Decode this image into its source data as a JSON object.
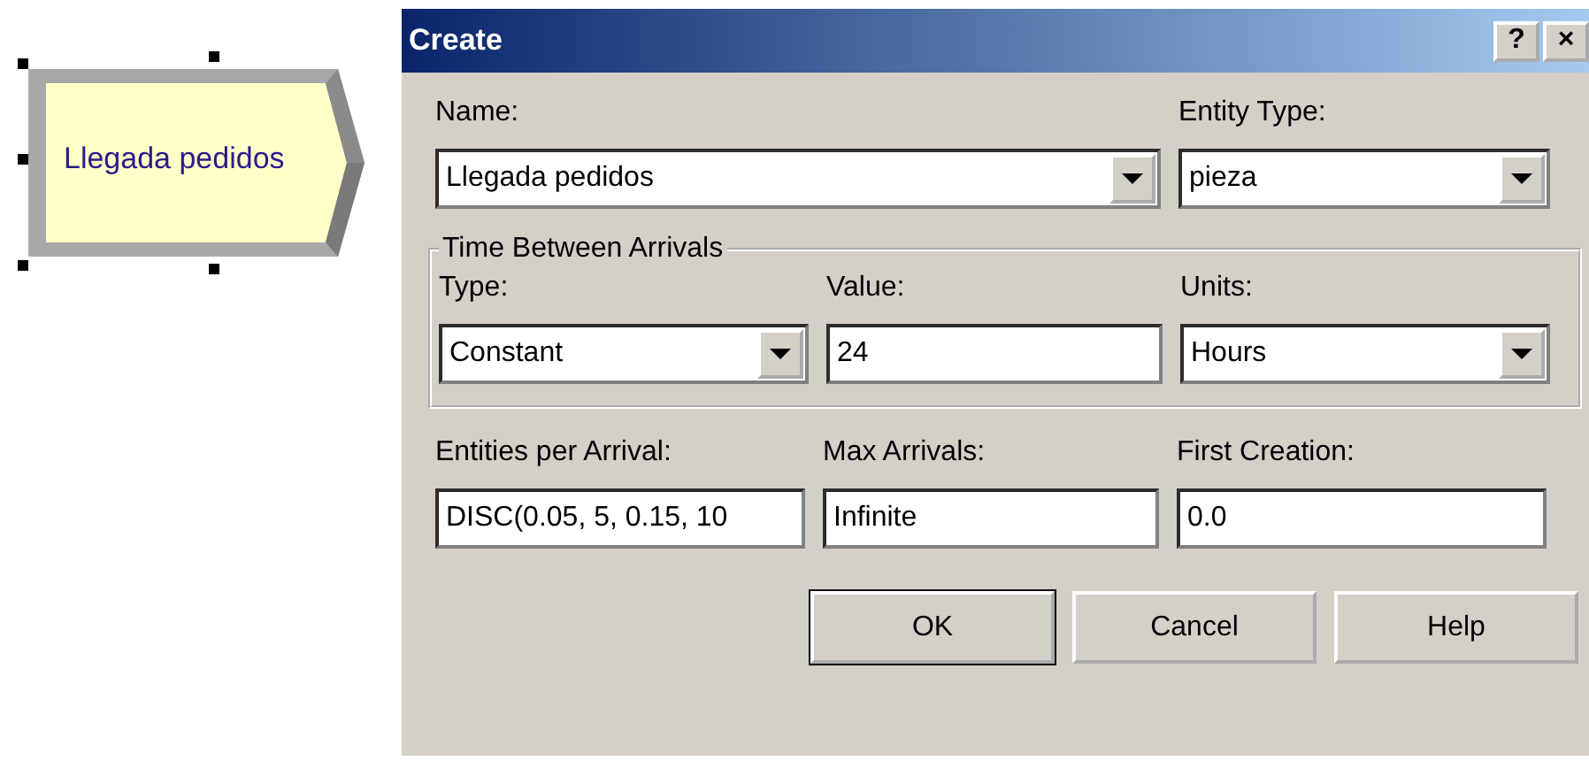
{
  "canvas": {
    "module": {
      "label": "Llegada pedidos",
      "selected": true
    }
  },
  "dialog": {
    "title": "Create",
    "title_buttons": [
      "?",
      "×"
    ],
    "top_fields": [
      {
        "label": "Name:",
        "kind": "combo",
        "value": "Llegada pedidos"
      },
      {
        "label": "Entity Type:",
        "kind": "combo",
        "value": "pieza"
      }
    ],
    "group": {
      "title": "Time Between Arrivals",
      "fields": [
        {
          "label": "Type:",
          "kind": "combo",
          "value": "Constant"
        },
        {
          "label": "Value:",
          "kind": "text",
          "value": "24"
        },
        {
          "label": "Units:",
          "kind": "combo",
          "value": "Hours"
        }
      ]
    },
    "bottom_fields": [
      {
        "label": "Entities per Arrival:",
        "value": "DISC(0.05, 5, 0.15, 10"
      },
      {
        "label": "Max Arrivals:",
        "value": "Infinite"
      },
      {
        "label": "First Creation:",
        "value": "0.0"
      }
    ],
    "buttons": [
      {
        "label": "OK",
        "default": true
      },
      {
        "label": "Cancel",
        "default": false
      },
      {
        "label": "Help",
        "default": false
      }
    ]
  }
}
